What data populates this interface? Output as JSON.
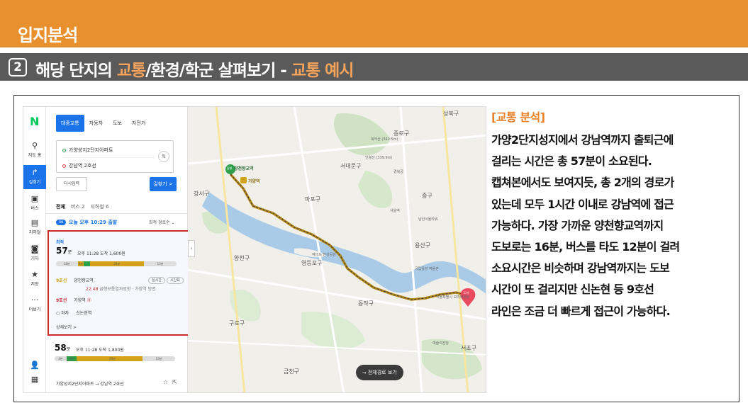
{
  "page": {
    "title": "입지분석",
    "section_number": "2",
    "heading_pre": "해당 단지의 ",
    "heading_accent1": "교통",
    "heading_mid": "/환경/학군 살펴보기 - ",
    "heading_accent2": "교통 예시"
  },
  "rail": {
    "logo": "N",
    "items": [
      {
        "label": "지도 홈",
        "icon": "pin-icon"
      },
      {
        "label": "길찾기",
        "icon": "directions-icon"
      },
      {
        "label": "버스",
        "icon": "bus-icon"
      },
      {
        "label": "지하철",
        "icon": "subway-icon"
      },
      {
        "label": "기차",
        "icon": "train-icon"
      },
      {
        "label": "저장",
        "icon": "star-icon"
      },
      {
        "label": "더보기",
        "icon": "more-icon"
      }
    ]
  },
  "panel": {
    "modes": [
      "대중교통",
      "자동차",
      "도보",
      "자전거"
    ],
    "origin": "가양성지2단지아파트",
    "destination": "강남역 2호선",
    "reset_label": "다시입력",
    "search_label": "길찾기 >",
    "result_tabs": [
      "전체",
      "버스 2",
      "지하철 6"
    ],
    "depart_toggle": "ON",
    "depart_text": "오늘 오후 10:29 출발",
    "sort_label": "최적 경로순",
    "route1": {
      "badge": "최적",
      "minutes": "57",
      "unit": "분",
      "arrive": "오후 11:28 도착   1,600원",
      "segments": [
        {
          "label": "10분",
          "share": 0.18,
          "color": "#dddddd"
        },
        {
          "label": "9분",
          "share": 0.05,
          "color": "#d2a21a"
        },
        {
          "label": "",
          "share": 0.05,
          "color": "#2e9e4a"
        },
        {
          "label": "23분",
          "share": 0.45,
          "color": "#d2a21a"
        },
        {
          "label": "13분",
          "share": 0.27,
          "color": "#dddddd"
        }
      ],
      "steps": [
        {
          "line": "9호선",
          "station": "양천향교역",
          "sub_time": "22:48",
          "sub_text": "급행보통열차방향 · 가양역 방면"
        },
        {
          "line": "9호선",
          "station": "가양역"
        },
        {
          "line": "하차",
          "station": "신논현역"
        }
      ],
      "pill_realtime": "실시간",
      "pill_schedule": "시간표",
      "detail": "상세보기 >"
    },
    "route2": {
      "minutes": "58",
      "unit": "분",
      "arrive": "오후 11:28 도착   1,800원",
      "segments": [
        {
          "label": "4분",
          "share": 0.1,
          "color": "#dddddd"
        },
        {
          "label": "4분",
          "share": 0.08,
          "color": "#2e9e4a"
        },
        {
          "label": "",
          "share": 0.05,
          "color": "#d2a21a"
        },
        {
          "label": "25분",
          "share": 0.5,
          "color": "#d2a21a"
        },
        {
          "label": "13분",
          "share": 0.27,
          "color": "#dddddd"
        }
      ]
    },
    "footer_route": "가양성지2단지아파트 → 강남역 2호선"
  },
  "map": {
    "full_route_label": "전체경로 보기",
    "labels": {
      "seongbuk": "성북구",
      "jongno": "종로구",
      "seodaemun": "서대문구",
      "mapo": "마포구",
      "gangseo": "강서구",
      "jung": "중구",
      "yongsan": "용산구",
      "yangcheon": "양천구",
      "yeongdeungpo": "영등포구",
      "dongjak": "동작구",
      "guro": "구로구",
      "geumcheon": "금천구",
      "seocho": "서초구",
      "start_station": "양천향교역",
      "gayang_station": "가양역",
      "start_badge": "출발",
      "end_badge": "도착",
      "bugaksan": "북악산 (342.5m)",
      "inwangsan": "인왕산 (339.9m)",
      "gyeongbokgung": "경복궁",
      "seoul_station": "서울역",
      "namsan": "남산서울타워",
      "hanwha": "한화진상스 아파트",
      "yeouido": "여의도 한강공원",
      "national_museum": "국립중앙 박물관",
      "gangnam_hospital": "서울특별시 보라매병원",
      "seoul_arts": "예술의전당"
    }
  },
  "analysis": {
    "heading": "[교통 분석]",
    "lines": [
      "가양2단지성지에서 강남역까지 출퇴근에",
      "걸리는 시간은 총 57분이 소요된다.",
      "캡쳐본에서도 보여지듯, 총 2개의 경로가",
      "있는데 모두 1시간 이내로 강남역에 접근",
      "가능하다. 가장 가까운 양천향교역까지",
      "도보로는 16분, 버스를 타도 12분이 걸려",
      "소요시간은 비슷하며 강남역까지는 도보",
      "시간이 또 걸리지만 신논현 등 9호선",
      "라인은 조금 더 빠르게 접근이 가능하다."
    ]
  },
  "colors": {
    "accent_orange": "#e8902e",
    "section_gray": "#5a5a5a",
    "naver_blue": "#1a73e8",
    "highlight_red": "#c92a2a",
    "line9_gold": "#d2a21a",
    "river_blue": "#a9cbe8"
  }
}
